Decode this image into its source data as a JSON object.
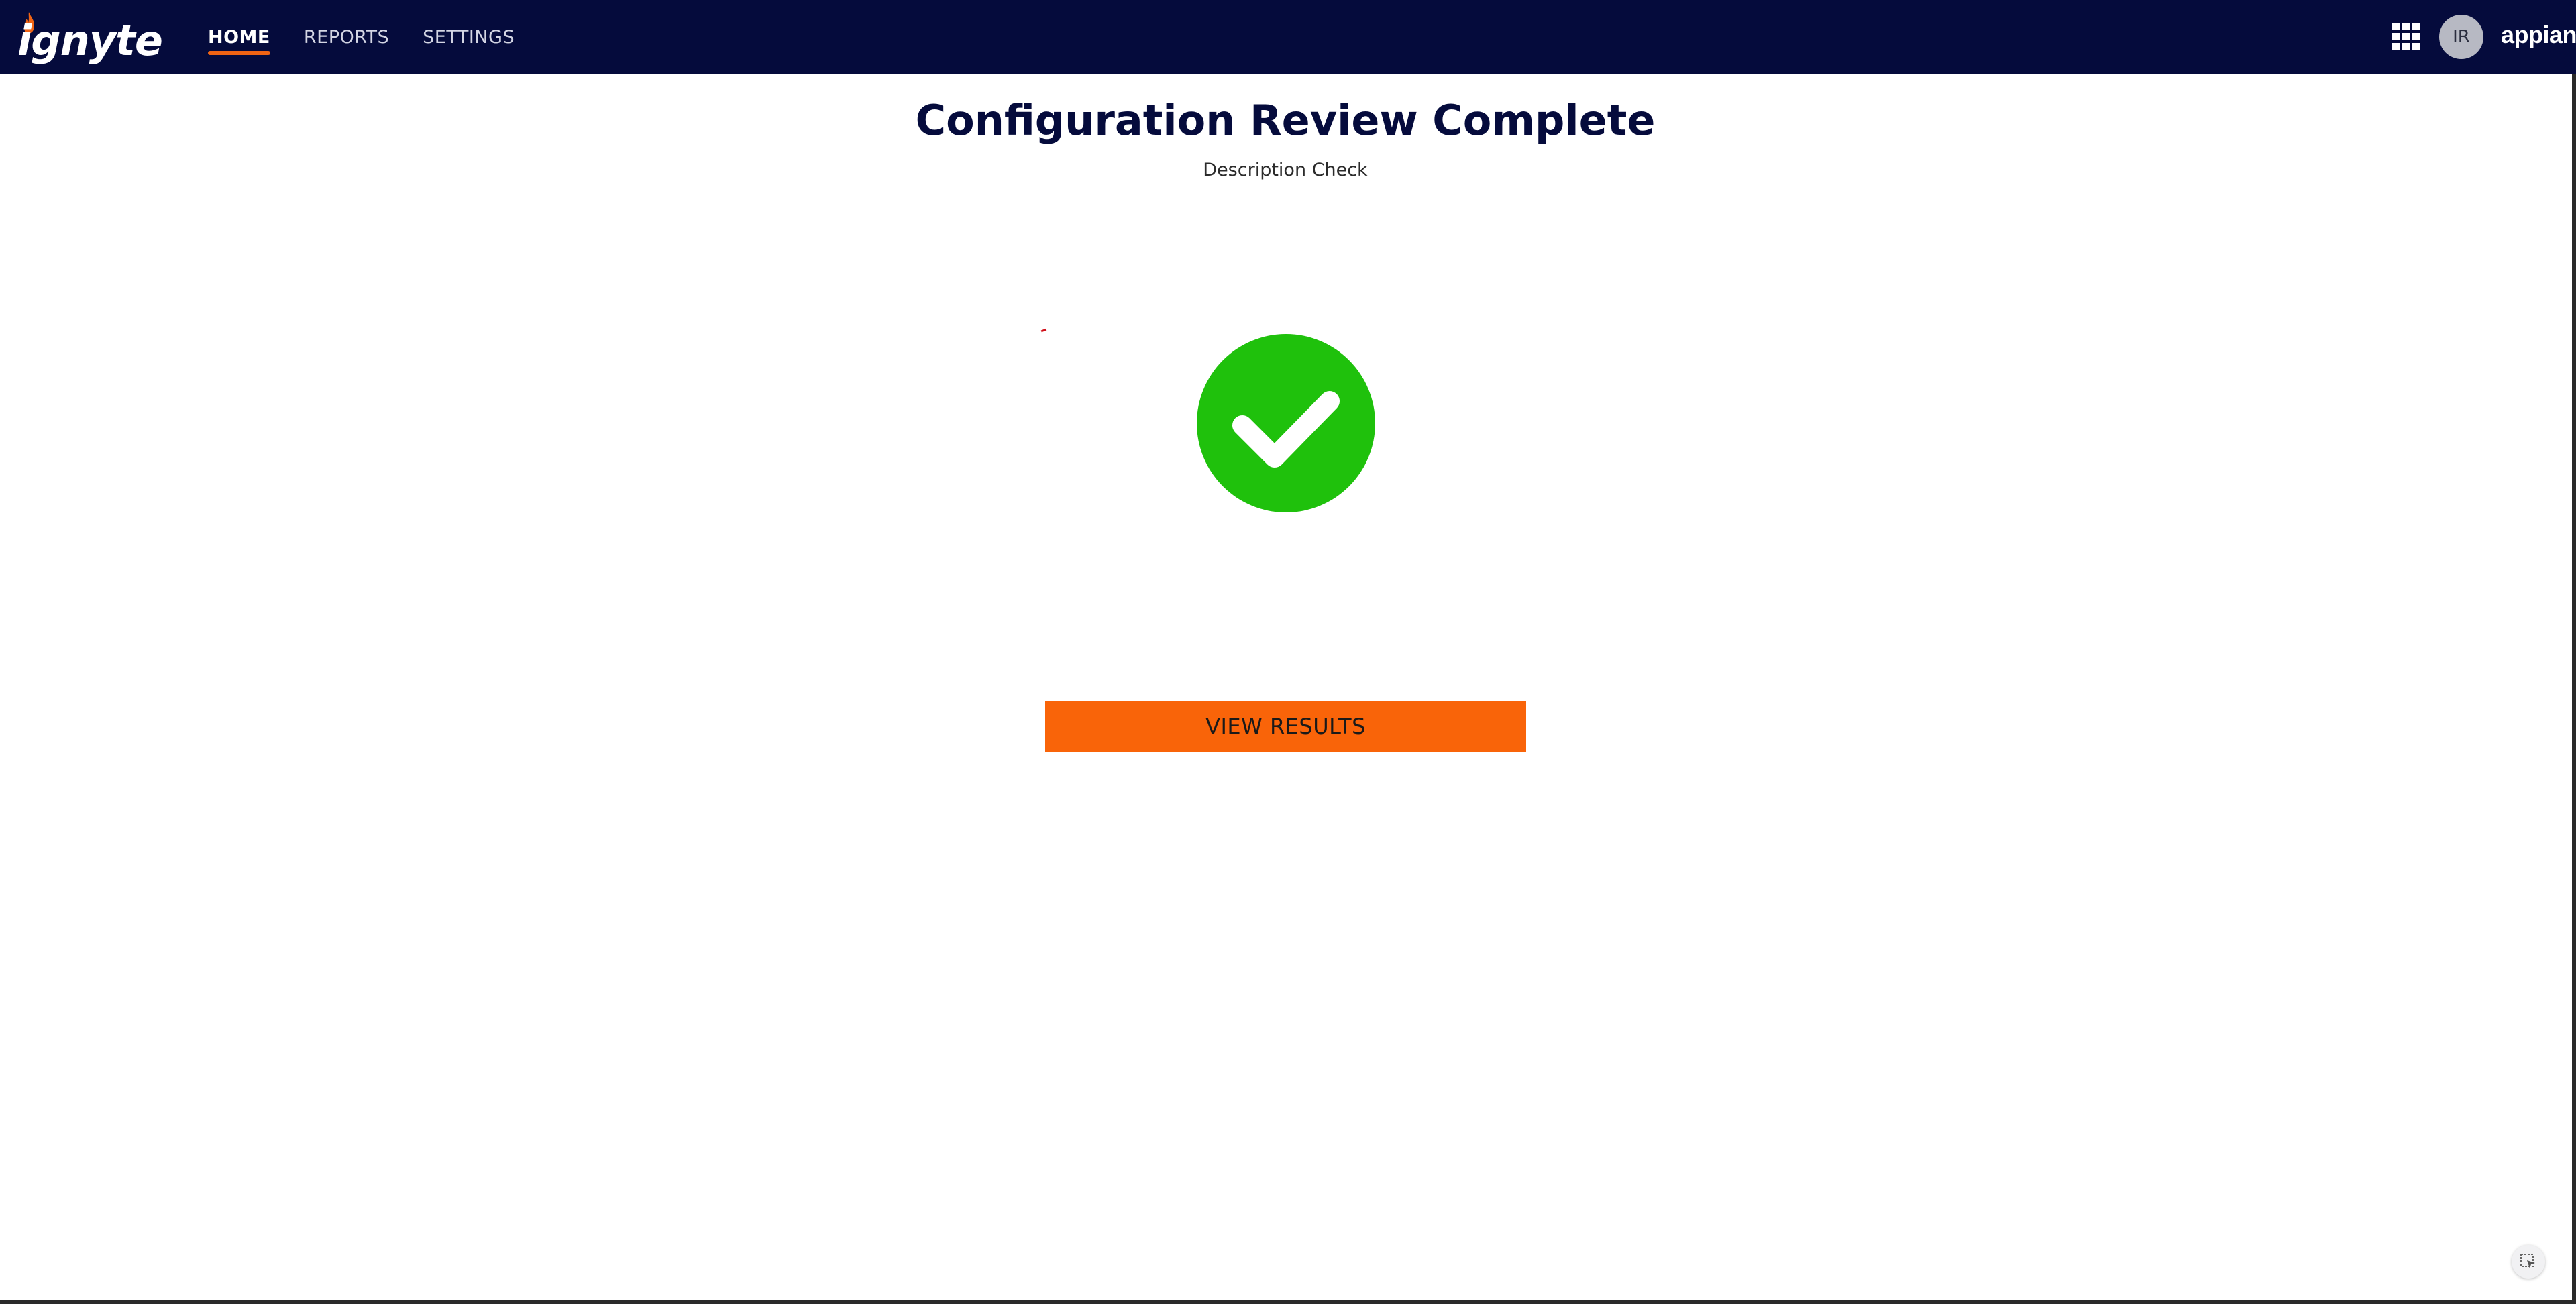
{
  "header": {
    "logo_text": "ignyte",
    "tabs": [
      {
        "label": "HOME",
        "active": true
      },
      {
        "label": "REPORTS",
        "active": false
      },
      {
        "label": "SETTINGS",
        "active": false
      }
    ],
    "apps_icon": "grid-icon",
    "avatar_initials": "IR",
    "brand": "appian"
  },
  "main": {
    "title": "Configuration Review Complete",
    "subtitle": "Description Check",
    "status_icon": "check-circle-icon",
    "view_results_label": "VIEW RESULTS"
  },
  "footer": {
    "corner_icon": "cursor-select-icon"
  },
  "colors": {
    "nav_background": "#050b3c",
    "accent_orange": "#f96409",
    "tab_underline": "#f06414",
    "success_green": "#1fc10c",
    "title_color": "#050b3c"
  }
}
